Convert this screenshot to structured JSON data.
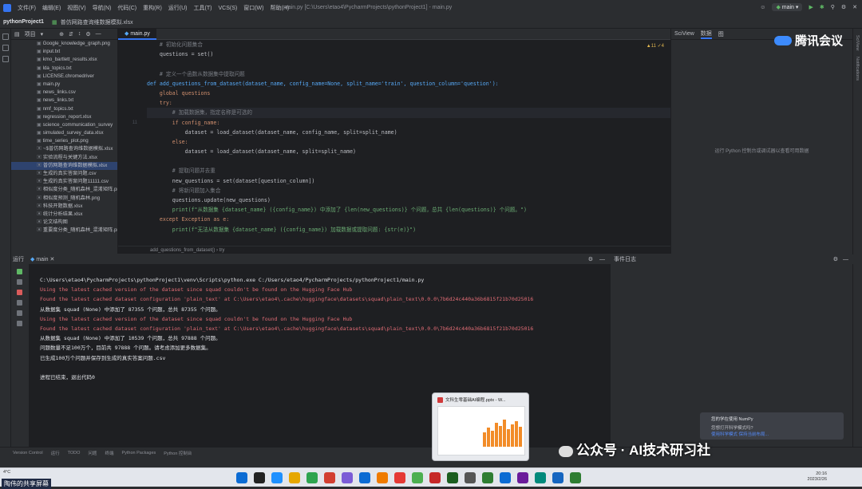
{
  "menubar": {
    "items": [
      "文件(F)",
      "编辑(E)",
      "视图(V)",
      "导航(N)",
      "代码(C)",
      "重构(R)",
      "运行(U)",
      "工具(T)",
      "VCS(S)",
      "窗口(W)",
      "帮助(H)"
    ],
    "title": "main.py [C:\\Users\\etao4\\PycharmProjects\\pythonProject1] - main.py",
    "run_config": "main"
  },
  "titlebar": {
    "project": "pythonProject1",
    "open_file": "普仿网路查询维数据模拟.xlsx"
  },
  "project_panel": {
    "header": "项目",
    "files": [
      {
        "name": "Google_knowledge_graph.png",
        "selected": false,
        "red": false
      },
      {
        "name": "input.txt",
        "selected": false,
        "red": false
      },
      {
        "name": "kmo_bartlett_results.xlsx",
        "selected": false,
        "red": false
      },
      {
        "name": "lda_topics.txt",
        "selected": false,
        "red": false
      },
      {
        "name": "LICENSE.chromedriver",
        "selected": false,
        "red": false
      },
      {
        "name": "main.py",
        "selected": false,
        "red": false
      },
      {
        "name": "news_links.csv",
        "selected": false,
        "red": false
      },
      {
        "name": "news_links.txt",
        "selected": false,
        "red": false
      },
      {
        "name": "nmf_topics.txt",
        "selected": false,
        "red": false
      },
      {
        "name": "regression_report.xlsx",
        "selected": false,
        "red": false
      },
      {
        "name": "science_communication_survey",
        "selected": false,
        "red": false
      },
      {
        "name": "simulated_survey_data.xlsx",
        "selected": false,
        "red": false
      },
      {
        "name": "time_series_plot.png",
        "selected": false,
        "red": false
      },
      {
        "name": "~$普仿网路查询维数据模拟.xlsx",
        "selected": false,
        "red": false
      },
      {
        "name": "实验流程与关键方法.xlsx",
        "selected": false,
        "red": false
      },
      {
        "name": "普仿网路查询维数据模拟.xlsx",
        "selected": true,
        "red": false
      },
      {
        "name": "生成的真实答案问题.csv",
        "selected": false,
        "red": false
      },
      {
        "name": "生成的真实答案问题11111.csv",
        "selected": false,
        "red": false
      },
      {
        "name": "相似度分类_随机森林_混淆矩阵.pr",
        "selected": false,
        "red": false
      },
      {
        "name": "相似度预测_随机森林.png",
        "selected": false,
        "red": false
      },
      {
        "name": "科技开题数据.xlsx",
        "selected": false,
        "red": false
      },
      {
        "name": "统计分析结果.xlsx",
        "selected": false,
        "red": false
      },
      {
        "name": "论文结构图",
        "selected": false,
        "red": false
      },
      {
        "name": "重要度分类_随机森林_混淆矩阵.pr",
        "selected": false,
        "red": false
      }
    ]
  },
  "editor": {
    "tab": "main.py",
    "hints": "▲11 ✓4",
    "breadcrumb": "add_questions_from_dataset()  ›  try",
    "line_numbers": [
      "",
      "",
      "",
      "",
      "",
      "",
      "",
      "",
      "11",
      "",
      "",
      "",
      "",
      "",
      "",
      "",
      "",
      "",
      "",
      "",
      ""
    ],
    "lines": [
      {
        "text": "    # 初始化问题集合",
        "cls": "cm",
        "cur": false
      },
      {
        "text": "    questions = set()",
        "cls": "",
        "cur": false
      },
      {
        "text": "",
        "cls": "",
        "cur": false
      },
      {
        "text": "    # 定义一个函数从数据集中提取问题",
        "cls": "cm",
        "cur": false
      },
      {
        "text": "def add_questions_from_dataset(dataset_name, config_name=None, split_name='train', question_column='question'):",
        "cls": "fn",
        "cur": false
      },
      {
        "text": "    global questions",
        "cls": "kw",
        "cur": false
      },
      {
        "text": "    try:",
        "cls": "kw",
        "cur": false
      },
      {
        "text": "        # 加载数据集，指定名称是可选的",
        "cls": "cm",
        "cur": true
      },
      {
        "text": "        if config_name:",
        "cls": "kw",
        "cur": false
      },
      {
        "text": "            dataset = load_dataset(dataset_name, config_name, split=split_name)",
        "cls": "",
        "cur": false
      },
      {
        "text": "        else:",
        "cls": "kw",
        "cur": false
      },
      {
        "text": "            dataset = load_dataset(dataset_name, split=split_name)",
        "cls": "",
        "cur": false
      },
      {
        "text": "",
        "cls": "",
        "cur": false
      },
      {
        "text": "        # 提取问题并去重",
        "cls": "cm",
        "cur": false
      },
      {
        "text": "        new_questions = set(dataset[question_column])",
        "cls": "",
        "cur": false
      },
      {
        "text": "        # 将新问题加入集合",
        "cls": "cm",
        "cur": false
      },
      {
        "text": "        questions.update(new_questions)",
        "cls": "",
        "cur": false
      },
      {
        "text": "        print(f\"从数据集 {dataset_name} ({config_name}) 中添加了 {len(new_questions)} 个问题，总共 {len(questions)} 个问题。\")",
        "cls": "str",
        "cur": false
      },
      {
        "text": "    except Exception as e:",
        "cls": "kw",
        "cur": false
      },
      {
        "text": "        print(f\"无法从数据集 {dataset_name} ({config_name}) 加载数据或提取问题: {str(e)}\")",
        "cls": "str",
        "cur": false
      },
      {
        "text": "",
        "cls": "",
        "cur": false
      }
    ]
  },
  "sciview": {
    "tabs": [
      "SciView",
      "数据",
      "图"
    ],
    "message": "运行 Python 控制台或调试器以查看可用数据",
    "meeting_label": "腾讯会议"
  },
  "right_strip": [
    "SciView",
    "Notifications"
  ],
  "run_panel": {
    "label": "运行",
    "tab": "main",
    "lines": [
      {
        "text": "C:\\Users\\etao4\\PycharmProjects\\pythonProject1\\venv\\Scripts\\python.exe C:/Users/etao4/PycharmProjects/pythonProject1/main.py",
        "cls": "out"
      },
      {
        "text": "Using the latest cached version of the dataset since squad couldn't be found on the Hugging Face Hub",
        "cls": "err"
      },
      {
        "text": "Found the latest cached dataset configuration 'plain_text' at C:\\Users\\etao4\\.cache\\huggingface\\datasets\\squad\\plain_text\\0.0.0\\7b6d24c440a36b6815f21b70d25016",
        "cls": "err"
      },
      {
        "text": "从数据集 squad (None) 中添加了 87355 个问题，总共 87355 个问题。",
        "cls": "out"
      },
      {
        "text": "Using the latest cached version of the dataset since squad couldn't be found on the Hugging Face Hub",
        "cls": "err"
      },
      {
        "text": "Found the latest cached dataset configuration 'plain_text' at C:\\Users\\etao4\\.cache\\huggingface\\datasets\\squad\\plain_text\\0.0.0\\7b6d24c440a36b6815f21b70d25016",
        "cls": "err"
      },
      {
        "text": "从数据集 squad (None) 中添加了 10539 个问题，总共 97888 个问题。",
        "cls": "out"
      },
      {
        "text": "问题数量不足100万个，目前共 97888 个问题。请考虑添加更多数据集。",
        "cls": "out"
      },
      {
        "text": "已生成100万个问题并保存到生成的真实答案问题.csv",
        "cls": "out"
      },
      {
        "text": "",
        "cls": "out"
      },
      {
        "text": "进程已结束，退出代码0",
        "cls": "out"
      }
    ]
  },
  "events": {
    "label": "事件日志",
    "notification": {
      "title": "您的学在使用 NumPy",
      "desc": "您想打开科学模式吗?",
      "link": "使用科学模式  保持当前布局..."
    }
  },
  "statusbar": {
    "items": [
      "Version Control",
      "运行",
      "TODO",
      "问题",
      "终端",
      "Python Packages",
      "Python 控制台"
    ]
  },
  "taskbar": {
    "weather": "4°C",
    "share_label": "陶伟的共享屏幕",
    "time": "20:16",
    "date": "2023/2/26"
  },
  "preview": {
    "title": "文科生零基础AI编程.pptx - W..."
  },
  "watermark": {
    "text": "公众号 · AI技术研习社"
  },
  "colors": {
    "accent": "#3574f0",
    "error": "#e06c75",
    "selection": "#2e436e"
  }
}
